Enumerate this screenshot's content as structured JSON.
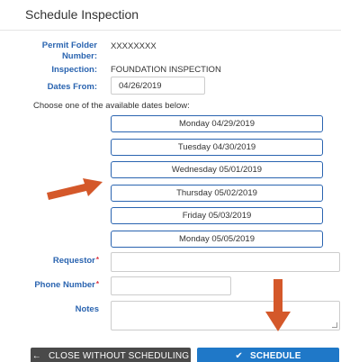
{
  "dialog": {
    "title": "Schedule Inspection"
  },
  "form": {
    "permit_label": "Permit Folder Number:",
    "permit_value": "XXXXXXXX",
    "inspection_label": "Inspection:",
    "inspection_value": "FOUNDATION INSPECTION",
    "dates_from_label": "Dates From:",
    "dates_from_value": "04/26/2019",
    "choose_text": "Choose one of the available dates below:",
    "dates": [
      "Monday 04/29/2019",
      "Tuesday 04/30/2019",
      "Wednesday 05/01/2019",
      "Thursday 05/02/2019",
      "Friday 05/03/2019",
      "Monday 05/05/2019"
    ],
    "requestor_label": "Requestor",
    "phone_label": "Phone Number",
    "notes_label": "Notes",
    "required_mark": "*"
  },
  "buttons": {
    "close_label": "CLOSE WITHOUT SCHEDULING",
    "close_icon": "←",
    "schedule_label": "SCHEDULE",
    "schedule_icon": "✔"
  },
  "colors": {
    "label": "#2a64b0",
    "date_border": "#2a64b0",
    "required": "#d9303e",
    "close_bg": "#4a4a4a",
    "schedule_bg": "#1f78c8",
    "annotation_arrow": "#d4582a"
  }
}
